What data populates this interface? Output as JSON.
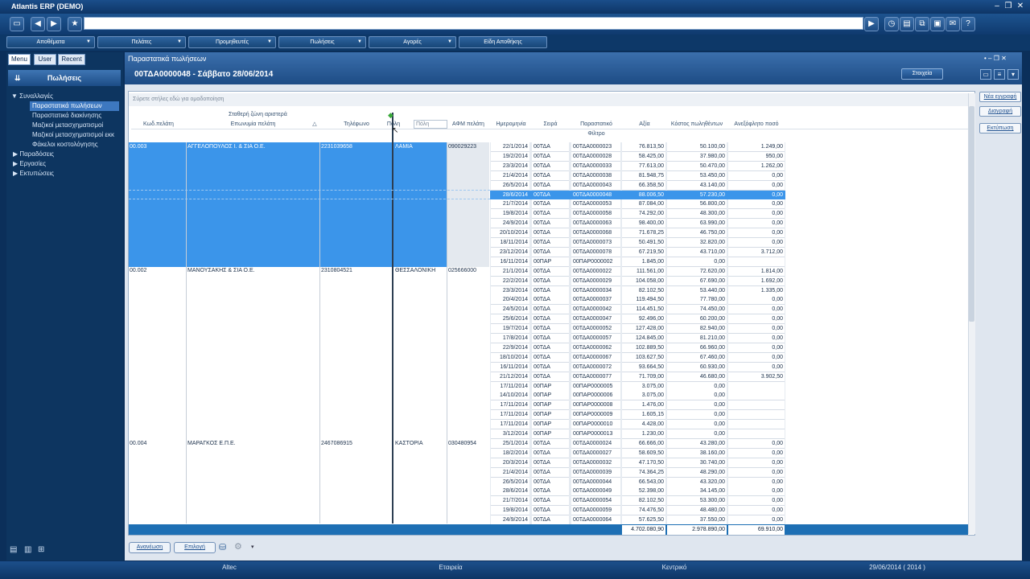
{
  "app_title": "Atlantis ERP (DEMO)",
  "menu": [
    "Αποθέματα",
    "Πελάτες",
    "Προμηθευτές",
    "Πωλήσεις",
    "Αγορές",
    "Είδη Αποθήκης"
  ],
  "side_tabs": [
    "Menu",
    "User",
    "Recent"
  ],
  "side_header": "Πωλήσεις",
  "tree": [
    "▼ Συναλλαγές",
    "Παραστατικά πωλήσεων",
    "Παραστατικά διακίνησης",
    "Μαζικοί μετασχηματισμοί",
    "Μαζικοί μετασχηματισμοί εκκ",
    "Φάκελοι κοστολόγησης",
    "▶ Παραδόσεις",
    "▶ Εργασίες",
    "▶ Εκτυπώσεις"
  ],
  "window_title": "Παραστατικά πωλήσεων",
  "doc_title": "00ΤΔΑ0000048 - Σάββατο 28/06/2014",
  "stoixeia": "Στοιχεία",
  "group_hint": "Σύρετε στήλες εδώ για ομαδοποίηση",
  "fixed_zone": "Σταθερή ζώνη αριστερά",
  "columns": [
    "Κωδ.πελάτη",
    "Επωνυμία πελάτη",
    "Τηλέφωνο",
    "Πόλη",
    "ΑΦΜ πελάτη",
    "Ημερομηνία",
    "Σειρά",
    "Παραστατικό",
    "Αξία",
    "Κόστος πωληθέντων",
    "Ανεξόφλητο ποσό"
  ],
  "filter_label": "Φίλτρο",
  "city_filter": "Πόλη",
  "customers": [
    {
      "code": "00.003",
      "name": "ΑΓΓΕΛΟΠΟΥΛΟΣ Ι. & ΣΙΑ Ο.Ε.",
      "phone": "2231039658",
      "city": "ΛΑΜΙΑ",
      "afm": "090029223"
    },
    {
      "code": "00.002",
      "name": "ΜΑΝΟΥΣΑΚΗΣ & ΣΙΑ Ο.Ε.",
      "phone": "2310804521",
      "city": "ΘΕΣΣΑΛΟΝΙΚΗ",
      "afm": "025666000"
    },
    {
      "code": "00.004",
      "name": "ΜΑΡΑΓΚΟΣ Ε.Π.Ε.",
      "phone": "2467086915",
      "city": "ΚΑΣΤΟΡΙΑ",
      "afm": "030480954"
    }
  ],
  "rows": [
    [
      "22/1/2014",
      "00ΤΔΑ",
      "00ΤΔΑ0000023",
      "76.813,50",
      "50.100,00",
      "1.249,00"
    ],
    [
      "19/2/2014",
      "00ΤΔΑ",
      "00ΤΔΑ0000028",
      "58.425,00",
      "37.980,00",
      "950,00"
    ],
    [
      "23/3/2014",
      "00ΤΔΑ",
      "00ΤΔΑ0000033",
      "77.613,00",
      "50.470,00",
      "1.262,00"
    ],
    [
      "21/4/2014",
      "00ΤΔΑ",
      "00ΤΔΑ0000038",
      "81.948,75",
      "53.450,00",
      "0,00"
    ],
    [
      "26/5/2014",
      "00ΤΔΑ",
      "00ΤΔΑ0000043",
      "66.358,50",
      "43.140,00",
      "0,00"
    ],
    [
      "28/6/2014",
      "00ΤΔΑ",
      "00ΤΔΑ0000048",
      "88.006,50",
      "57.230,00",
      "0,00"
    ],
    [
      "21/7/2014",
      "00ΤΔΑ",
      "00ΤΔΑ0000053",
      "87.084,00",
      "56.800,00",
      "0,00"
    ],
    [
      "19/8/2014",
      "00ΤΔΑ",
      "00ΤΔΑ0000058",
      "74.292,00",
      "48.300,00",
      "0,00"
    ],
    [
      "24/9/2014",
      "00ΤΔΑ",
      "00ΤΔΑ0000063",
      "98.400,00",
      "63.990,00",
      "0,00"
    ],
    [
      "20/10/2014",
      "00ΤΔΑ",
      "00ΤΔΑ0000068",
      "71.678,25",
      "46.750,00",
      "0,00"
    ],
    [
      "18/11/2014",
      "00ΤΔΑ",
      "00ΤΔΑ0000073",
      "50.491,50",
      "32.820,00",
      "0,00"
    ],
    [
      "23/12/2014",
      "00ΤΔΑ",
      "00ΤΔΑ0000078",
      "67.219,50",
      "43.710,00",
      "3.712,00"
    ],
    [
      "16/11/2014",
      "00ΠΑΡ",
      "00ΠΑΡ0000002",
      "1.845,00",
      "0,00",
      ""
    ],
    [
      "21/1/2014",
      "00ΤΔΑ",
      "00ΤΔΑ0000022",
      "111.561,00",
      "72.620,00",
      "1.814,00"
    ],
    [
      "22/2/2014",
      "00ΤΔΑ",
      "00ΤΔΑ0000029",
      "104.058,00",
      "67.690,00",
      "1.692,00"
    ],
    [
      "23/3/2014",
      "00ΤΔΑ",
      "00ΤΔΑ0000034",
      "82.102,50",
      "53.440,00",
      "1.335,00"
    ],
    [
      "20/4/2014",
      "00ΤΔΑ",
      "00ΤΔΑ0000037",
      "119.494,50",
      "77.780,00",
      "0,00"
    ],
    [
      "24/5/2014",
      "00ΤΔΑ",
      "00ΤΔΑ0000042",
      "114.451,50",
      "74.450,00",
      "0,00"
    ],
    [
      "25/6/2014",
      "00ΤΔΑ",
      "00ΤΔΑ0000047",
      "92.496,00",
      "60.200,00",
      "0,00"
    ],
    [
      "19/7/2014",
      "00ΤΔΑ",
      "00ΤΔΑ0000052",
      "127.428,00",
      "82.940,00",
      "0,00"
    ],
    [
      "17/8/2014",
      "00ΤΔΑ",
      "00ΤΔΑ0000057",
      "124.845,00",
      "81.210,00",
      "0,00"
    ],
    [
      "22/9/2014",
      "00ΤΔΑ",
      "00ΤΔΑ0000062",
      "102.889,50",
      "66.960,00",
      "0,00"
    ],
    [
      "18/10/2014",
      "00ΤΔΑ",
      "00ΤΔΑ0000067",
      "103.627,50",
      "67.460,00",
      "0,00"
    ],
    [
      "16/11/2014",
      "00ΤΔΑ",
      "00ΤΔΑ0000072",
      "93.664,50",
      "60.930,00",
      "0,00"
    ],
    [
      "21/12/2014",
      "00ΤΔΑ",
      "00ΤΔΑ0000077",
      "71.709,00",
      "46.680,00",
      "3.902,50"
    ],
    [
      "17/11/2014",
      "00ΠΑΡ",
      "00ΠΑΡ0000005",
      "3.075,00",
      "0,00",
      ""
    ],
    [
      "14/10/2014",
      "00ΠΑΡ",
      "00ΠΑΡ0000006",
      "3.075,00",
      "0,00",
      ""
    ],
    [
      "17/11/2014",
      "00ΠΑΡ",
      "00ΠΑΡ0000008",
      "1.476,00",
      "0,00",
      ""
    ],
    [
      "17/11/2014",
      "00ΠΑΡ",
      "00ΠΑΡ0000009",
      "1.605,15",
      "0,00",
      ""
    ],
    [
      "17/11/2014",
      "00ΠΑΡ",
      "00ΠΑΡ0000010",
      "4.428,00",
      "0,00",
      ""
    ],
    [
      "3/12/2014",
      "00ΠΑΡ",
      "00ΠΑΡ0000013",
      "1.230,00",
      "0,00",
      ""
    ],
    [
      "25/1/2014",
      "00ΤΔΑ",
      "00ΤΔΑ0000024",
      "66.666,00",
      "43.280,00",
      "0,00"
    ],
    [
      "18/2/2014",
      "00ΤΔΑ",
      "00ΤΔΑ0000027",
      "58.609,50",
      "38.160,00",
      "0,00"
    ],
    [
      "20/3/2014",
      "00ΤΔΑ",
      "00ΤΔΑ0000032",
      "47.170,50",
      "30.740,00",
      "0,00"
    ],
    [
      "21/4/2014",
      "00ΤΔΑ",
      "00ΤΔΑ0000039",
      "74.364,25",
      "48.290,00",
      "0,00"
    ],
    [
      "26/5/2014",
      "00ΤΔΑ",
      "00ΤΔΑ0000044",
      "66.543,00",
      "43.320,00",
      "0,00"
    ],
    [
      "28/6/2014",
      "00ΤΔΑ",
      "00ΤΔΑ0000049",
      "52.398,00",
      "34.145,00",
      "0,00"
    ],
    [
      "21/7/2014",
      "00ΤΔΑ",
      "00ΤΔΑ0000054",
      "82.102,50",
      "53.300,00",
      "0,00"
    ],
    [
      "19/8/2014",
      "00ΤΔΑ",
      "00ΤΔΑ0000059",
      "74.476,50",
      "48.480,00",
      "0,00"
    ],
    [
      "24/9/2014",
      "00ΤΔΑ",
      "00ΤΔΑ0000064",
      "57.625,50",
      "37.550,00",
      "0,00"
    ]
  ],
  "totals": [
    "4.702.080,90",
    "2.978.890,00",
    "69.910,00"
  ],
  "right_buttons": [
    "Νέα εγγραφή",
    "Διαγραφή",
    "Εκτύπωση"
  ],
  "bottom_buttons": [
    "Ανανέωση",
    "Επιλογή"
  ],
  "status": [
    "Altec",
    "Εταιρεία",
    "Κεντρικό",
    "29/06/2014 ( 2014 )"
  ]
}
